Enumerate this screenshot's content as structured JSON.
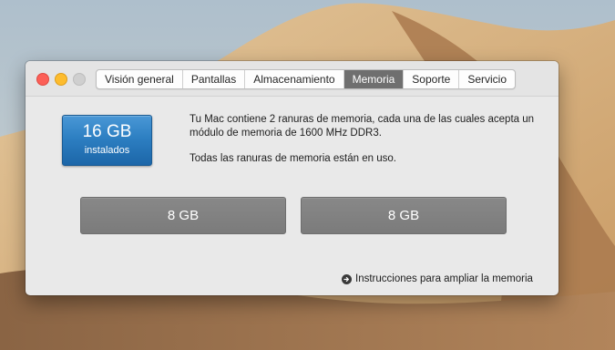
{
  "window": {
    "controls": {
      "close": "close-button",
      "minimize": "minimize-button",
      "zoom": "zoom-button"
    },
    "tabs": [
      {
        "label": "Visión general",
        "active": false
      },
      {
        "label": "Pantallas",
        "active": false
      },
      {
        "label": "Almacenamiento",
        "active": false
      },
      {
        "label": "Memoria",
        "active": true
      },
      {
        "label": "Soporte",
        "active": false
      },
      {
        "label": "Servicio",
        "active": false
      }
    ]
  },
  "memory": {
    "size": "16 GB",
    "installed_label": "instalados",
    "description": "Tu Mac contiene 2 ranuras de memoria, cada una de las cuales acepta un módulo de memoria de 1600 MHz DDR3.",
    "status": "Todas las ranuras de memoria están en uso.",
    "slots": [
      {
        "label": "8 GB"
      },
      {
        "label": "8 GB"
      }
    ],
    "upgrade_link": "Instrucciones para ampliar la memoria"
  },
  "colors": {
    "badge_blue": "#2d7fc2",
    "slot_gray": "#818181",
    "active_tab": "#6f6f6f",
    "close": "#fc5f57",
    "minimize": "#fdbc2e"
  },
  "icons": {
    "upgrade_link_icon": "arrow-circle-right-icon"
  }
}
